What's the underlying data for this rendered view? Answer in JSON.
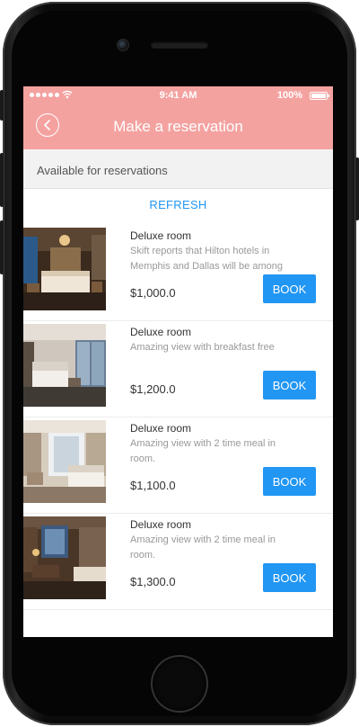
{
  "status_bar": {
    "time": "9:41 AM",
    "battery": "100%"
  },
  "nav": {
    "title": "Make a reservation",
    "back_icon": "chevron-left-icon"
  },
  "section": {
    "label": "Available for reservations"
  },
  "refresh_label": "REFRESH",
  "rooms": [
    {
      "name": "Deluxe room",
      "description": "Skift reports that Hilton hotels in Memphis and Dallas will be among",
      "price": "$1,000.0",
      "book_label": "BOOK"
    },
    {
      "name": "Deluxe room",
      "description": "Amazing view with breakfast free",
      "price": "$1,200.0",
      "book_label": "BOOK"
    },
    {
      "name": "Deluxe room",
      "description": "Amazing view with 2 time meal in room.",
      "price": "$1,100.0",
      "book_label": "BOOK"
    },
    {
      "name": "Deluxe room",
      "description": "Amazing view with 2 time meal in room.",
      "price": "$1,300.0",
      "book_label": "BOOK"
    }
  ],
  "colors": {
    "accent": "#2196f3",
    "header": "#f4a2a0"
  }
}
